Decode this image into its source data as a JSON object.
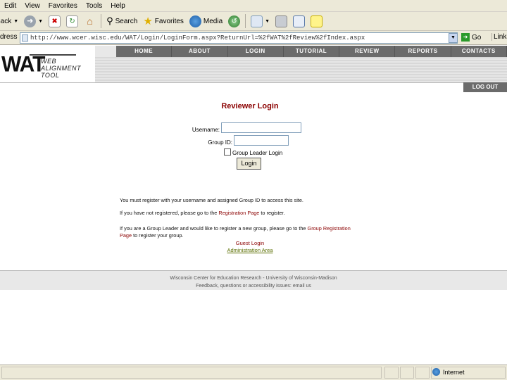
{
  "browser": {
    "menu": [
      "Edit",
      "View",
      "Favorites",
      "Tools",
      "Help"
    ],
    "toolbar": {
      "back_label": "Back",
      "search_label": "Search",
      "favorites_label": "Favorites",
      "media_label": "Media"
    },
    "address_label": "dress",
    "address_url": "http://www.wcer.wisc.edu/WAT/Login/LoginForm.aspx?ReturnUrl=%2fWAT%2fReview%2fIndex.aspx",
    "go_label": "Go",
    "links_label": "Links",
    "status_zone": "Internet"
  },
  "site": {
    "logo_big": "WAT",
    "logo_small_1": "WEB ALIGNMENT",
    "logo_small_2": "TOOL",
    "nav": [
      "HOME",
      "ABOUT",
      "LOGIN",
      "TUTORIAL",
      "REVIEW",
      "REPORTS",
      "CONTACTS"
    ],
    "logout": "LOG OUT"
  },
  "login": {
    "title": "Reviewer Login",
    "username_label": "Username:",
    "group_label": "Group ID:",
    "group_leader_label": "Group Leader Login",
    "button": "Login"
  },
  "info": {
    "line1": "You must register with your username and assigned Group ID to access this site.",
    "line2_pre": "If you have not registered, please go to the ",
    "line2_link": "Registration Page",
    "line2_post": " to register.",
    "line3_pre": "If you are a Group Leader and would like to register a new group, please go to the ",
    "line3_link1": "Group Registration",
    "line3_link2": "Page",
    "line3_post": " to register your group.",
    "guest_login": "Guest Login",
    "admin_area": "Administration Area"
  },
  "footer": {
    "line1": "Wisconsin Center for Education Research - University of Wisconsin-Madison",
    "line2": "Feedback, questions or accessibility issues: email us"
  }
}
